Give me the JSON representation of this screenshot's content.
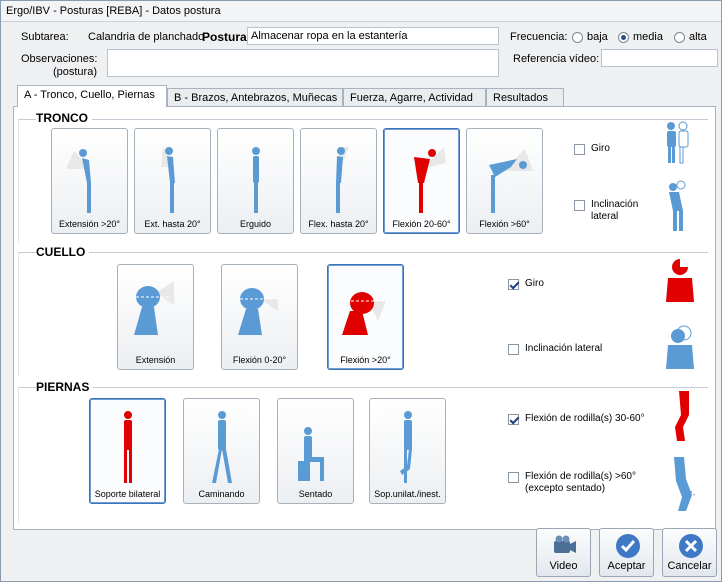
{
  "window": {
    "title": "Ergo/IBV - Posturas [REBA] - Datos postura"
  },
  "header": {
    "subtarea_label": "Subtarea:",
    "subtarea_value": "Calandria de planchado",
    "postura_label": "Postura:",
    "postura_value": "Almacenar ropa en la estantería",
    "frecuencia_label": "Frecuencia:",
    "frecuencia_options": [
      "baja",
      "media",
      "alta"
    ],
    "frecuencia_selected": "media",
    "observaciones_label": "Observaciones:",
    "observaciones_sub": "(postura)",
    "observaciones_value": "",
    "referencia_label": "Referencia vídeo:",
    "referencia_value": ""
  },
  "tabs": [
    {
      "label": "A - Tronco, Cuello, Piernas",
      "active": true
    },
    {
      "label": "B - Brazos, Antebrazos, Muñecas",
      "active": false
    },
    {
      "label": "Fuerza, Agarre, Actividad",
      "active": false
    },
    {
      "label": "Resultados",
      "active": false
    }
  ],
  "tronco": {
    "title": "TRONCO",
    "options": [
      "Extensión >20°",
      "Ext. hasta 20°",
      "Erguido",
      "Flex. hasta 20°",
      "Flexión 20-60°",
      "Flexión >60°"
    ],
    "selected": "Flexión 20-60°",
    "giro_label": "Giro",
    "giro_checked": false,
    "inclinacion_label_1": "Inclinación",
    "inclinacion_label_2": "lateral",
    "inclinacion_checked": false
  },
  "cuello": {
    "title": "CUELLO",
    "options": [
      "Extensión",
      "Flexión 0-20°",
      "Flexión >20°"
    ],
    "selected": "Flexión >20°",
    "giro_label": "Giro",
    "giro_checked": true,
    "inclinacion_label": "Inclinación lateral",
    "inclinacion_checked": false
  },
  "piernas": {
    "title": "PIERNAS",
    "options": [
      "Soporte bilateral",
      "Caminando",
      "Sentado",
      "Sop.unilat./inest."
    ],
    "selected": "Soporte bilateral",
    "rodilla_30_label": "Flexión de rodilla(s) 30-60°",
    "rodilla_30_checked": true,
    "rodilla_60_label_1": "Flexión de rodilla(s) >60°",
    "rodilla_60_label_2": "(excepto sentado)",
    "rodilla_60_checked": false
  },
  "buttons": {
    "video": "Video",
    "aceptar": "Aceptar",
    "cancelar": "Cancelar"
  },
  "colors": {
    "figure": "#5b9bd5",
    "selected_figure": "#e00000",
    "selected_border": "#3d73b8"
  }
}
